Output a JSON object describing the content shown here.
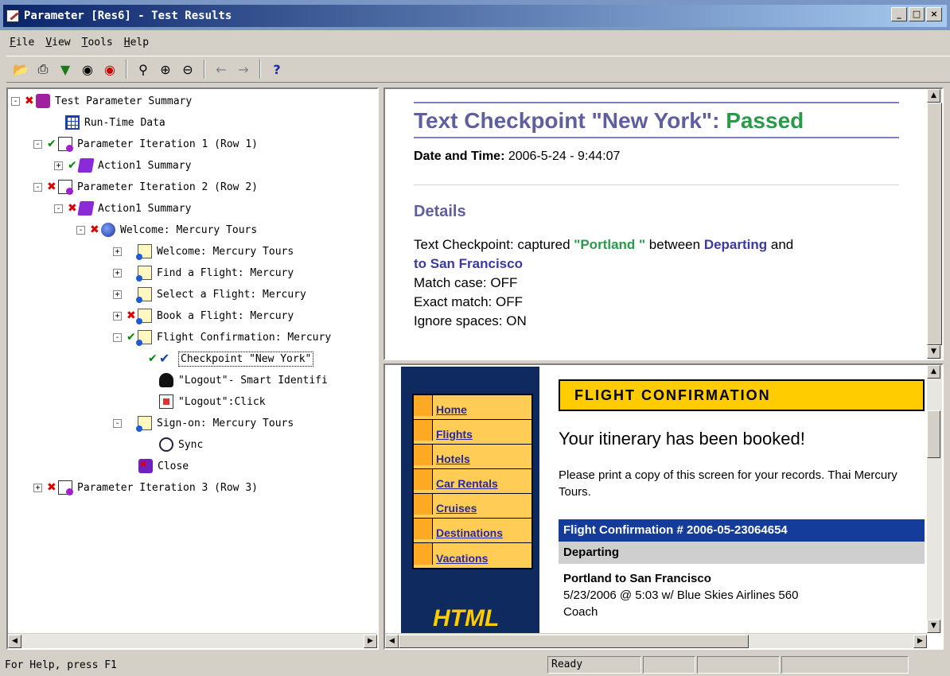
{
  "window": {
    "title": "Parameter [Res6] - Test Results",
    "buttons": [
      "_",
      "□",
      "×"
    ]
  },
  "menu": [
    "File",
    "View",
    "Tools",
    "Help"
  ],
  "toolbar": {
    "icons": [
      "open-icon",
      "print-icon",
      "filter-icon",
      "find-icon",
      "find-previous-icon",
      "zoom-fit-icon",
      "zoom-in-icon",
      "zoom-out-icon",
      "back-arrow-icon",
      "forward-arrow-icon",
      "help-icon"
    ]
  },
  "tree": [
    {
      "label": "Test Parameter Summary",
      "status": "fail",
      "icon": "summary-icon",
      "expand": "-"
    },
    {
      "label": "Run-Time Data",
      "status": "",
      "icon": "grid-icon",
      "expand": ""
    },
    {
      "label": "Parameter Iteration 1 (Row 1)",
      "status": "pass",
      "icon": "page-icon",
      "expand": "-"
    },
    {
      "label": "Action1 Summary",
      "status": "pass",
      "icon": "action-icon",
      "expand": "+"
    },
    {
      "label": "Parameter Iteration 2 (Row 2)",
      "status": "fail",
      "icon": "page-icon",
      "expand": "-"
    },
    {
      "label": "Action1 Summary",
      "status": "fail",
      "icon": "action-icon",
      "expand": "-"
    },
    {
      "label": "Welcome: Mercury Tours",
      "status": "fail",
      "icon": "globe-icon",
      "expand": "-"
    },
    {
      "label": "Welcome: Mercury Tours",
      "status": "",
      "icon": "page-doc-icon",
      "expand": "+"
    },
    {
      "label": "Find a Flight: Mercury",
      "status": "",
      "icon": "page-doc-icon",
      "expand": "+"
    },
    {
      "label": "Select a Flight: Mercury",
      "status": "",
      "icon": "page-doc-icon",
      "expand": "+"
    },
    {
      "label": "Book a Flight: Mercury",
      "status": "fail",
      "icon": "page-doc-icon",
      "expand": "+"
    },
    {
      "label": "Flight Confirmation: Mercury",
      "status": "pass",
      "icon": "page-doc-icon",
      "expand": "-"
    },
    {
      "label": "Checkpoint \"New York\"",
      "status": "pass",
      "icon": "checkpoint-icon",
      "expand": ""
    },
    {
      "label": "\"Logout\"- Smart Identifi",
      "status": "",
      "icon": "smart-id-icon",
      "expand": ""
    },
    {
      "label": "\"Logout\":Click",
      "status": "",
      "icon": "click-icon",
      "expand": ""
    },
    {
      "label": "Sign-on: Mercury Tours",
      "status": "",
      "icon": "page-doc-icon",
      "expand": "-"
    },
    {
      "label": "Sync",
      "status": "",
      "icon": "sync-icon",
      "expand": ""
    },
    {
      "label": "Close",
      "status": "",
      "icon": "close-app-icon",
      "expand": ""
    },
    {
      "label": "Parameter Iteration 3 (Row 3)",
      "status": "fail",
      "icon": "page-icon",
      "expand": "+"
    }
  ],
  "checkpoint": {
    "title_prefix": "Text Checkpoint \"New York\": ",
    "title_status": "Passed",
    "datetime_label": "Date and Time:",
    "datetime_value": " 2006-5-24 - 9:44:07",
    "details_heading": "Details",
    "line1_a": "Text Checkpoint: captured ",
    "line1_captured": "\"Portland \"",
    "line1_b": " between ",
    "line1_departing": "Departing",
    "line1_c": " and",
    "line2": "to San Francisco",
    "match_case": "Match case: OFF",
    "exact_match": "Exact match: OFF",
    "ignore_spaces": "Ignore spaces: ON"
  },
  "web": {
    "nav": [
      "Home",
      "Flights",
      "Hotels",
      "Car Rentals",
      "Cruises",
      "Destinations",
      "Vacations"
    ],
    "logo": "HTML",
    "banner": "FLIGHT CONFIRMATION",
    "itinerary": "Your itinerary has been booked!",
    "please": "Please print a copy of this screen for your records. Thai Mercury Tours.",
    "confirmation": "Flight Confirmation # 2006-05-23064654",
    "departing": "Departing",
    "route": "Portland to San Francisco",
    "flight": "5/23/2006 @ 5:03 w/ Blue Skies Airlines 560",
    "class": "Coach"
  },
  "status": {
    "help": "For Help, press F1",
    "state": "Ready"
  }
}
